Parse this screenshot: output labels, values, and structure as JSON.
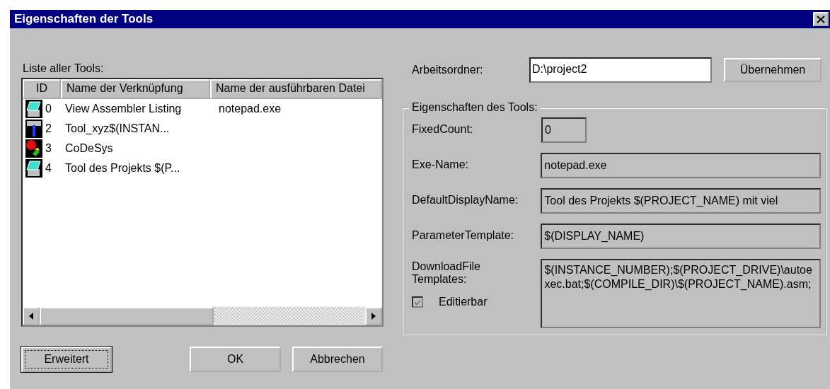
{
  "window": {
    "title": "Eigenschaften der Tools"
  },
  "tool_list": {
    "label": "Liste aller Tools:",
    "columns": [
      "ID",
      "Name der Verknüpfung",
      "Name der ausführbaren Datei"
    ],
    "rows": [
      {
        "kind": "notebook",
        "id": "0",
        "name": "View Assembler Listing",
        "file": "notepad.exe",
        "selected": false
      },
      {
        "kind": "figure",
        "id": "2",
        "name": "Tool_xyz$(INSTAN...",
        "file": "",
        "selected": false
      },
      {
        "kind": "codesys",
        "id": "3",
        "name": "CoDeSys",
        "file": "",
        "selected": false
      },
      {
        "kind": "notebook",
        "id": "4",
        "name": "Tool des Projekts $(P...",
        "file": "",
        "selected": false
      }
    ]
  },
  "buttons": [
    {
      "label": "Erweitert",
      "focused": true
    },
    {
      "label": "OK",
      "focused": false
    },
    {
      "label": "Abbrechen",
      "focused": false
    }
  ],
  "working_folder": {
    "label": "Arbeitsordner:",
    "value": "D:\\project2",
    "apply_button": "Übernehmen"
  },
  "tool_properties": {
    "title": "Eigenschaften des Tools:",
    "fields": [
      {
        "label": "FixedCount:",
        "value": "0",
        "kind": "short"
      },
      {
        "label": "Exe-Name:",
        "value": "notepad.exe",
        "kind": "line"
      },
      {
        "label": "DefaultDisplayName:",
        "value": "Tool des Projekts $(PROJECT_NAME) mit viel",
        "kind": "line"
      },
      {
        "label": "ParameterTemplate:",
        "value": "$(DISPLAY_NAME)",
        "kind": "line"
      },
      {
        "label": "DownloadFile Templates:",
        "value": "$(INSTANCE_NUMBER);$(PROJECT_DRIVE)\\autoexec.bat;$(COMPILE_DIR)\\$(PROJECT_NAME).asm;",
        "kind": "multi"
      }
    ],
    "editable": {
      "label": "Editierbar",
      "checked": true,
      "disabled": true
    }
  }
}
